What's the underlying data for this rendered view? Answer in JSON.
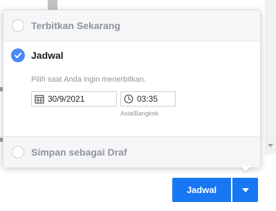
{
  "popover": {
    "publish_now_label": "Terbitkan Sekarang",
    "schedule_label": "Jadwal",
    "schedule_hint": "Pilih saat Anda ingin menerbitkan.",
    "date_value": "30/9/2021",
    "time_value": "03:35",
    "timezone": "Asia/Bangkok",
    "draft_label": "Simpan sebagai Draf"
  },
  "footer": {
    "schedule_button_label": "Jadwal"
  },
  "colors": {
    "accent": "#1877f2",
    "radio_checked": "#4a8af4"
  }
}
